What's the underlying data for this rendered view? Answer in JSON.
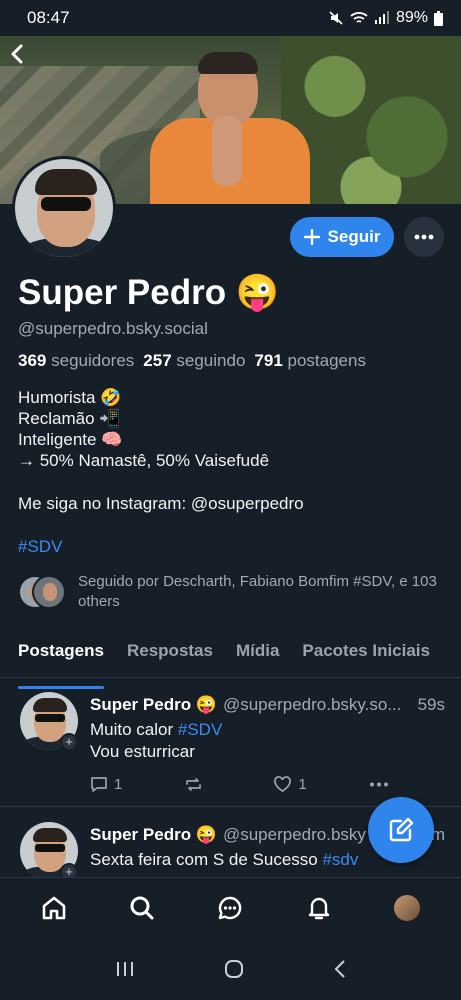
{
  "status_bar": {
    "time": "08:47",
    "battery": "89%"
  },
  "profile": {
    "display_name": "Super Pedro 😜",
    "handle": "@superpedro.bsky.social",
    "followers_count": "369",
    "followers_label": "seguidores",
    "following_count": "257",
    "following_label": "seguindo",
    "posts_count": "791",
    "posts_label": "postagens",
    "follow_button": "Seguir",
    "bio": {
      "line1": "Humorista 🤣",
      "line2": "Reclamão 📲",
      "line3": "Inteligente 🧠",
      "line4": "→ 50% Namastê, 50% Vaisefudê",
      "line5": "Me siga no Instagram: @osuperpedro",
      "hashtag": "#SDV"
    },
    "followed_by": "Seguido por Descharth, Fabiano Bomfim #SDV, e 103 others"
  },
  "tabs": [
    {
      "label": "Postagens",
      "active": true
    },
    {
      "label": "Respostas",
      "active": false
    },
    {
      "label": "Mídia",
      "active": false
    },
    {
      "label": "Pacotes Iniciais",
      "active": false
    }
  ],
  "posts": [
    {
      "author": "Super Pedro 😜",
      "handle": "@superpedro.bsky.so...",
      "time": "59s",
      "text_line1_prefix": "Muito calor ",
      "text_line1_tag": "#SDV",
      "text_line2": "Vou esturricar",
      "replies": "1",
      "likes": "1"
    },
    {
      "author": "Super Pedro 😜",
      "handle": "@superpedro.bsky",
      "time": "m",
      "text_line1_prefix": "Sexta feira com S de Sucesso ",
      "text_line1_tag": "#sdv"
    }
  ],
  "colors": {
    "accent": "#2f85ec",
    "background": "#161e27",
    "muted": "#a0aab6"
  },
  "icons": [
    "back-icon",
    "plus-icon",
    "ellipsis-icon",
    "reply-icon",
    "repost-icon",
    "like-icon",
    "compose-icon",
    "home-icon",
    "search-icon",
    "chat-icon",
    "bell-icon"
  ]
}
